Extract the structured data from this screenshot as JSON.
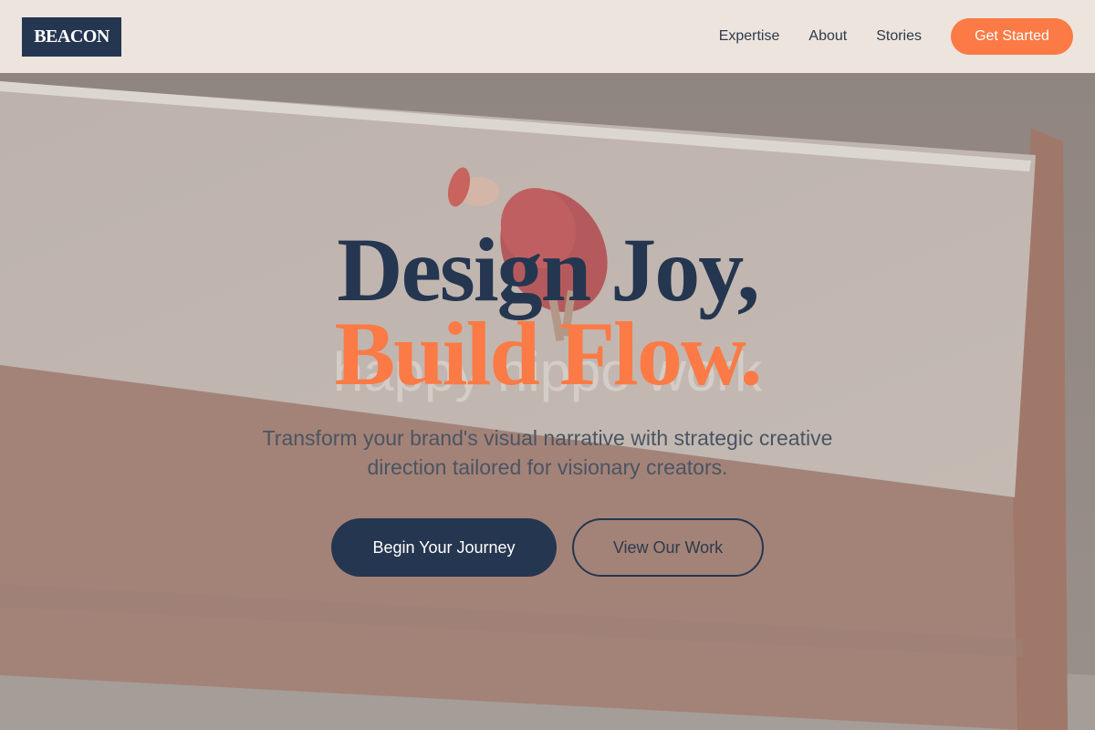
{
  "header": {
    "logo_text": "BEACON",
    "nav": [
      {
        "label": "Expertise"
      },
      {
        "label": "About"
      },
      {
        "label": "Stories"
      }
    ],
    "cta_label": "Get Started"
  },
  "hero": {
    "title_line1": "Design Joy,",
    "title_line2": "Build Flow.",
    "subtitle": "Transform your brand's visual narrative with strategic creative direction tailored for visionary creators.",
    "primary_button": "Begin Your Journey",
    "secondary_button": "View Our Work",
    "background_watermark": "happy hippo work"
  },
  "colors": {
    "navy": "#253650",
    "accent": "#fb7a45",
    "header_bg": "#f0e8e1",
    "text_muted": "#4a5463"
  }
}
